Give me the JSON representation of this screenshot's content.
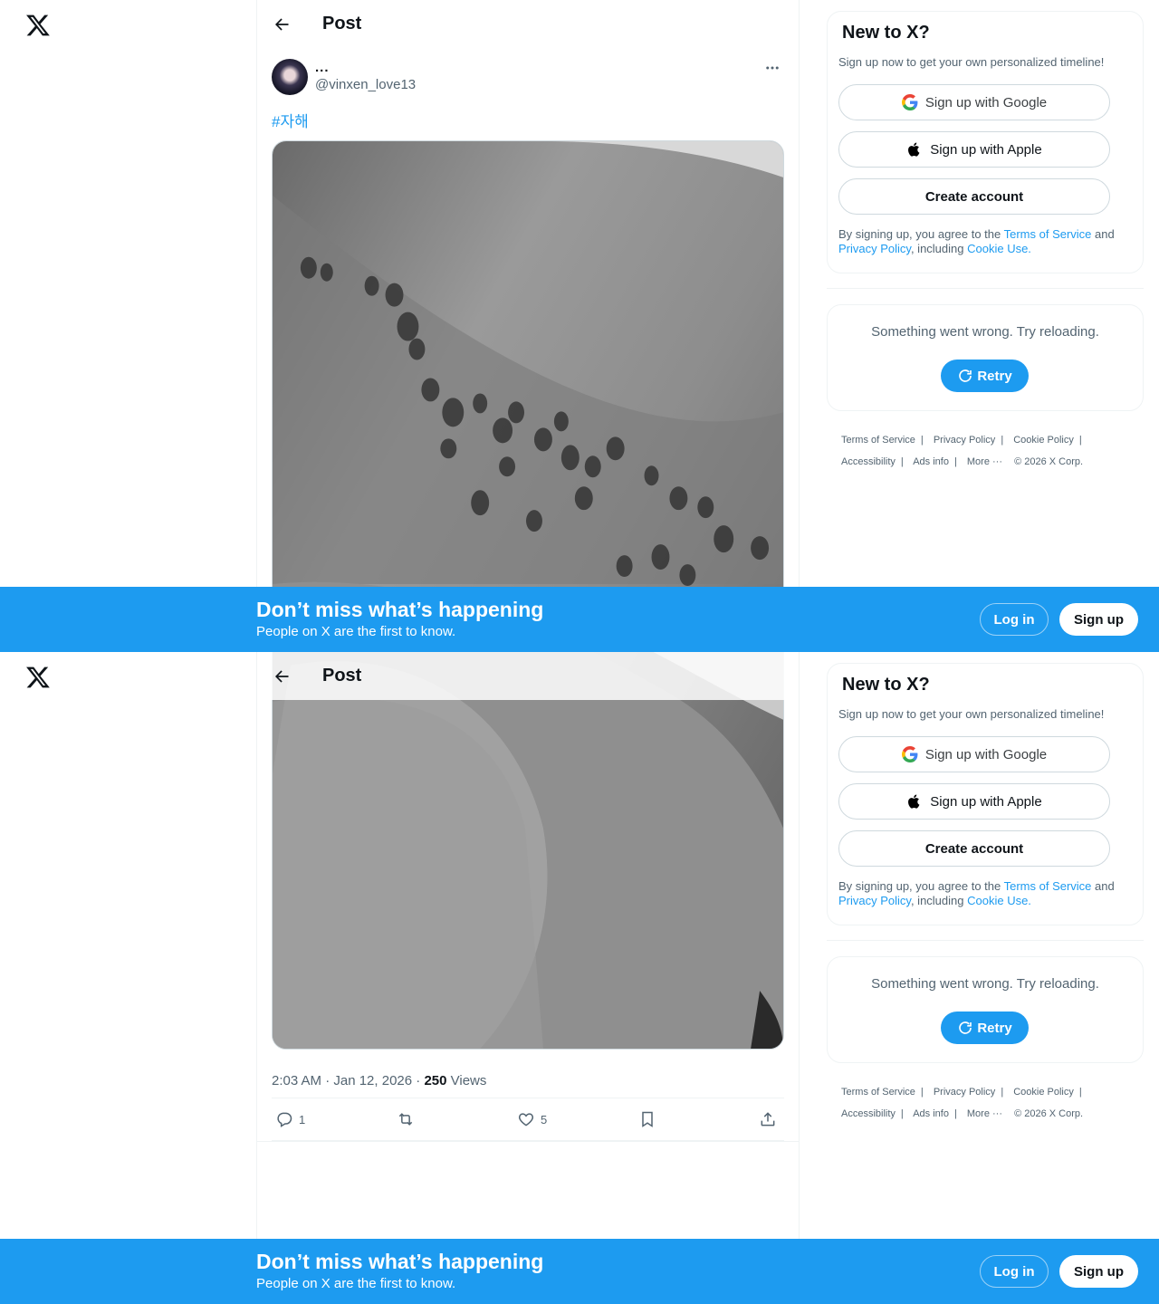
{
  "header": {
    "title": "Post",
    "back_label": "Back"
  },
  "post": {
    "author_name": "...",
    "author_handle": "@vinxen_love13",
    "hashtag": "#자해",
    "time": "2:03 AM · Jan 12, 2026 · ",
    "views_count": "250",
    "views_label": " Views",
    "replies": "1",
    "reposts": "",
    "likes": "5"
  },
  "signup_card": {
    "title": "New to X?",
    "subtitle": "Sign up now to get your own personalized timeline!",
    "google_label": "Sign up with Google",
    "apple_label": "Sign up with Apple",
    "create_label": "Create account",
    "legal_prefix": "By signing up, you agree to the ",
    "tos_link": "Terms of Service",
    "legal_and": " and ",
    "privacy_link": "Privacy Policy",
    "legal_including": ", including ",
    "cookie_link": "Cookie Use."
  },
  "error_card": {
    "message": "Something went wrong. Try reloading.",
    "retry_label": "Retry"
  },
  "footer": {
    "terms": "Terms of Service",
    "privacy": "Privacy Policy",
    "cookie": "Cookie Policy",
    "accessibility": "Accessibility",
    "ads": "Ads info",
    "more": "More ···",
    "copyright": "© 2026 X Corp."
  },
  "banner": {
    "title": "Don’t miss what’s happening",
    "subtitle": "People on X are the first to know.",
    "login_label": "Log in",
    "signup_label": "Sign up"
  },
  "colors": {
    "accent": "#1d9bf0",
    "text": "#0f1419",
    "muted": "#536471",
    "border": "#eff3f4"
  }
}
